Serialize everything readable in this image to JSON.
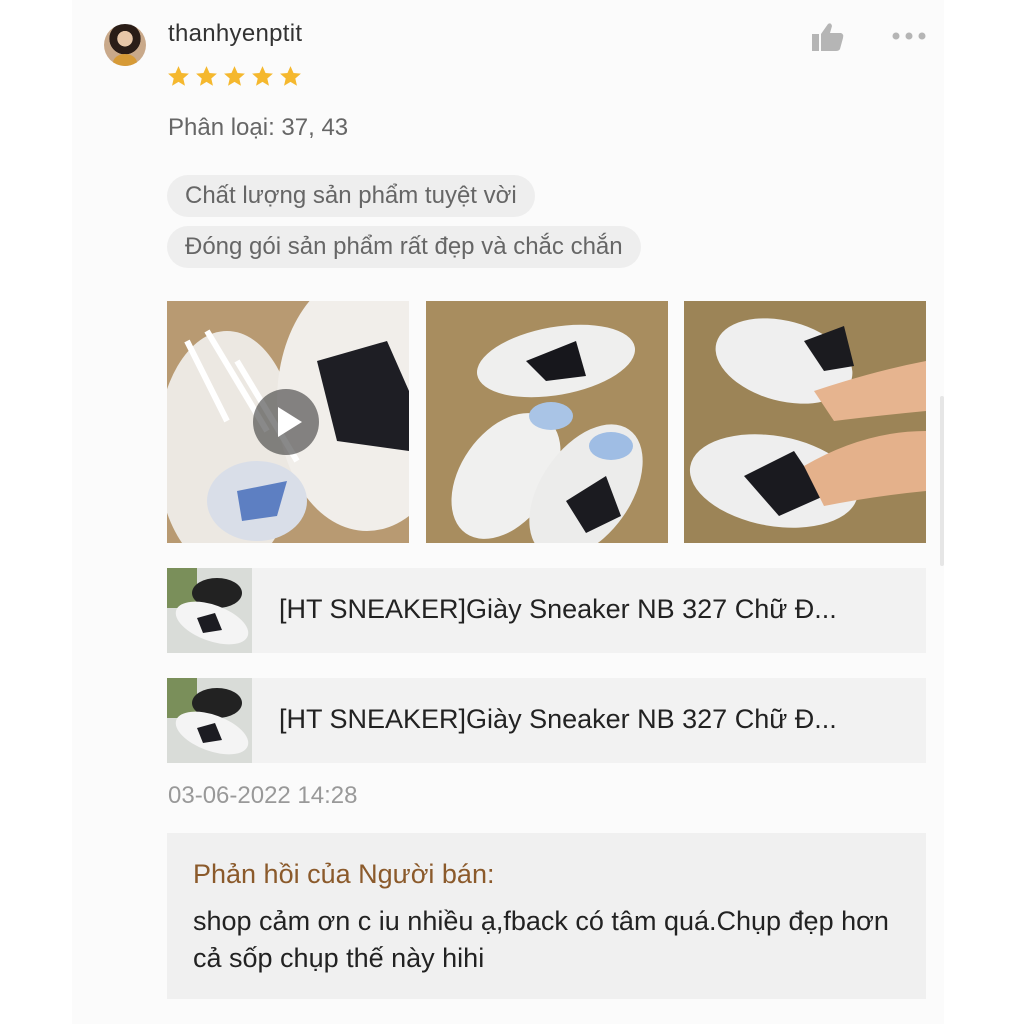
{
  "review": {
    "username": "thanhyenptit",
    "rating": 5,
    "variant": "Phân loại: 37, 43",
    "tags": [
      "Chất lượng sản phẩm tuyệt vời",
      "Đóng gói sản phẩm rất đẹp và chắc chắn"
    ],
    "timestamp": "03-06-2022 14:28"
  },
  "media": [
    {
      "type": "video",
      "alt": "sneaker-video"
    },
    {
      "type": "image",
      "alt": "sneaker-photo"
    },
    {
      "type": "image",
      "alt": "sneaker-worn-photo"
    }
  ],
  "products": [
    {
      "title": "[HT SNEAKER]Giày Sneaker NB 327 Chữ Đ..."
    },
    {
      "title": "[HT SNEAKER]Giày Sneaker NB 327 Chữ Đ..."
    }
  ],
  "seller_reply": {
    "title": "Phản hồi của Người bán:",
    "text": "shop cảm ơn c iu nhiều ạ,fback có tâm quá.Chụp đẹp hơn cả sốp chụp thế này hihi"
  },
  "icons": {
    "like": "thumbs-up-icon",
    "more": "more-options-icon",
    "star": "star-icon",
    "play": "play-icon"
  },
  "colors": {
    "star": "#f5b82e",
    "reply_title": "#8b5a2b",
    "tag_bg": "#eeeeee"
  }
}
